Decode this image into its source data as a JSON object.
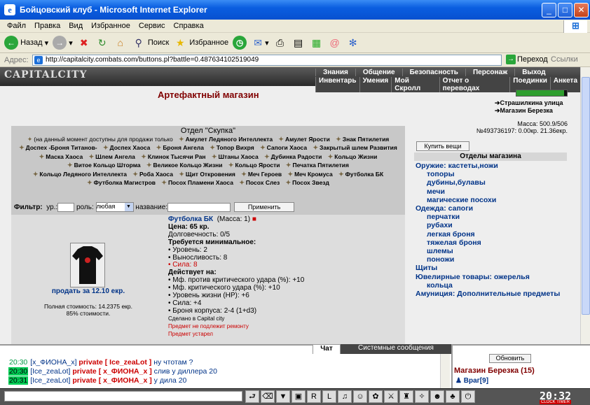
{
  "window": {
    "title": "Бойцовский клуб - Microsoft Internet Explorer",
    "min": "_",
    "max": "□",
    "close": "✕"
  },
  "menu": [
    "Файл",
    "Правка",
    "Вид",
    "Избранное",
    "Сервис",
    "Справка"
  ],
  "toolbar": {
    "back": "Назад",
    "search": "Поиск",
    "favorites": "Избранное"
  },
  "address": {
    "label": "Адрес:",
    "url": "http://capitalcity.combats.com/buttons.pl?battle=0.487634102519049",
    "go": "Переход",
    "links": "Ссылки"
  },
  "site": {
    "logo": "CAPITALCITY",
    "menu_top": [
      "Знания",
      "Общение",
      "Безопасность",
      "Персонаж",
      "Выход"
    ],
    "menu_bottom": [
      "Инвентарь",
      "Умения",
      "Мой Скролл",
      "Отчет о переводах",
      "Поединки",
      "Анкета"
    ],
    "shop_title": "Артефактный магазин",
    "nav_links": [
      "Страшилкина улица",
      "Магазин Березка"
    ],
    "mass_line": "Масса: 500.9/506",
    "money_line": "№493736197: 0.00кр. 21.36екр.",
    "buy_button": "Купить вещи",
    "departments_title": "Отделы магазина",
    "categories": [
      {
        "label": "Оружие: кастеты,ножи",
        "sub": false
      },
      {
        "label": "топоры",
        "sub": true
      },
      {
        "label": "дубины,булавы",
        "sub": true
      },
      {
        "label": "мечи",
        "sub": true
      },
      {
        "label": "магические посохи",
        "sub": true
      },
      {
        "label": "Одежда: сапоги",
        "sub": false
      },
      {
        "label": "перчатки",
        "sub": true
      },
      {
        "label": "рубахи",
        "sub": true
      },
      {
        "label": "легкая броня",
        "sub": true
      },
      {
        "label": "тяжелая броня",
        "sub": true
      },
      {
        "label": "шлемы",
        "sub": true
      },
      {
        "label": "поножи",
        "sub": true
      },
      {
        "label": "Щиты",
        "sub": false
      },
      {
        "label": "Ювелирные товары: ожерелья",
        "sub": false
      },
      {
        "label": "кольца",
        "sub": true
      },
      {
        "label": "Амуниция: Дополнительные предметы",
        "sub": false
      }
    ],
    "skupka_title": "Отдел \"Скупка\"",
    "skupka_note": "(на данный момент доступны для продажи только",
    "artifacts": [
      "Амулет Ледяного Интеллекта",
      "Амулет Ярости",
      "Знак Пятилетия",
      "Доспех -Броня Титанов-",
      "Доспех Хаоса",
      "Броня Ангела",
      "Топор Вихря",
      "Сапоги Хаоса",
      "Закрытый шлем Развития",
      "Маска Хаоса",
      "Шлем Ангела",
      "Клинок Тысячи Ран",
      "Штаны Хаоса",
      "Дубинка Радости",
      "Кольцо Жизни",
      "Витое Кольцо Шторма",
      "Великое Кольцо Жизни",
      "Кольцо Ярости",
      "Печатка Пятилетия",
      "Кольцо Ледяного Интеллекта",
      "Роба Хаоса",
      "Щит Откровения",
      "Меч Героев",
      "Меч Кромуса",
      "Футболка БК",
      "Футболка Магистров",
      "Посох Пламени Хаоса",
      "Посох Слез",
      "Посох Звезд"
    ],
    "filter": {
      "label": "Фильтр:",
      "level": "ур.:",
      "role": "роль:",
      "role_value": "любая",
      "name": "название:",
      "apply": "Применить"
    },
    "item": {
      "name": "Футболка БК",
      "mass": "(Масса: 1)",
      "price": "Цена: 65 кр.",
      "durability": "Долговечность: 0/5",
      "req_title": "Требуется минимальное:",
      "req": [
        "• Уровень: 2",
        "• Выносливость: 8"
      ],
      "req_red": "• Сила: 8",
      "act_title": "Действует на:",
      "act": [
        "• Мф. против критического удара (%): +10",
        "• Мф. критического удара (%): +10",
        "• Уровень жизни (HP): +6",
        "• Сила: +4",
        "• Броня корпуса: 2-4 (1+d3)"
      ],
      "made": "Сделано в Capital city",
      "no_repair": "Предмет не подлежит ремонту",
      "outdated": "Предмет устарел",
      "sell": "продать за 12.10 екр.",
      "full_cost": "Полная стоимость: 14.2375 екр.",
      "percent": "85% стоимости."
    }
  },
  "chat": {
    "tab_chat": "Чат",
    "tab_system": "Системные сообщения",
    "lines": [
      {
        "time": "20:30",
        "user": "[x_ФИОНА_x]",
        "priv": "private [ Ice_zeaLot ]",
        "text": "ну чтотам ?",
        "hl": false
      },
      {
        "time": "20:30",
        "user": "[Ice_zeaLot]",
        "priv": "private [ x_ФИОНА_x ]",
        "text": "слив у диллера 20",
        "hl": true
      },
      {
        "time": "20:31",
        "user": "[Ice_zeaLot]",
        "priv": "private [ x_ФИОНА_x ]",
        "text": "у дила 20",
        "hl": true
      }
    ]
  },
  "right": {
    "refresh": "Обновить",
    "shop": "Магазин Березка (15)",
    "user": "Враг[9]"
  },
  "clock": {
    "time": "20:32",
    "label": "CLOCK TIMER"
  }
}
